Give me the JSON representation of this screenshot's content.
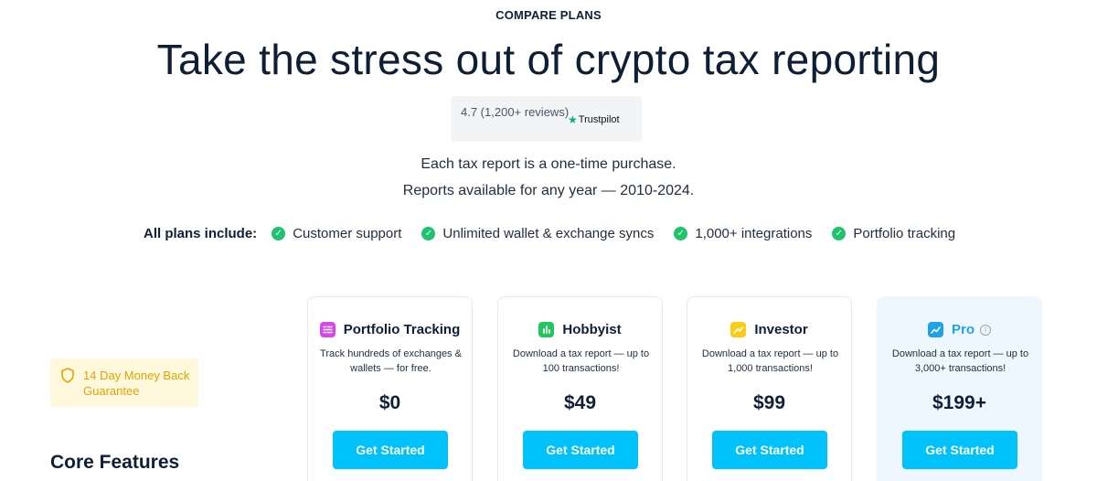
{
  "header": {
    "eyebrow": "COMPARE PLANS",
    "title": "Take the stress out of crypto tax reporting"
  },
  "rating": {
    "text": "4.7 (1,200+ reviews)",
    "brand": "Trustpilot"
  },
  "subtitle": {
    "line1": "Each tax report is a one-time purchase.",
    "line2": "Reports available for any year — 2010-2024."
  },
  "includes": {
    "label": "All plans include:",
    "items": [
      "Customer support",
      "Unlimited wallet & exchange syncs",
      "1,000+ integrations",
      "Portfolio tracking"
    ]
  },
  "guarantee": {
    "text": "14 Day Money Back Guarantee"
  },
  "core_features": {
    "title": "Core Features"
  },
  "plans": [
    {
      "name": "Portfolio Tracking",
      "description": "Track hundreds of exchanges & wallets — for free.",
      "price": "$0",
      "cta": "Get Started",
      "icon": "portfolio-icon",
      "color": "#d946ef"
    },
    {
      "name": "Hobbyist",
      "description": "Download a tax report — up to 100 transactions!",
      "price": "$49",
      "cta": "Get Started",
      "icon": "bar-chart-icon",
      "color": "#22c55e"
    },
    {
      "name": "Investor",
      "description": "Download a tax report — up to 1,000 transactions!",
      "price": "$99",
      "cta": "Get Started",
      "icon": "trend-icon",
      "color": "#facc15"
    },
    {
      "name": "Pro",
      "description": "Download a tax report — up to 3,000+ transactions!",
      "price": "$199+",
      "cta": "Get Started",
      "icon": "pro-chart-icon",
      "color": "#1fa3e6"
    }
  ],
  "colors": {
    "accent": "#00c2fb",
    "check": "#1ec46b",
    "guarantee_bg": "#fff8dc",
    "guarantee_text": "#e3a400",
    "pro_bg": "#eef7fd"
  }
}
